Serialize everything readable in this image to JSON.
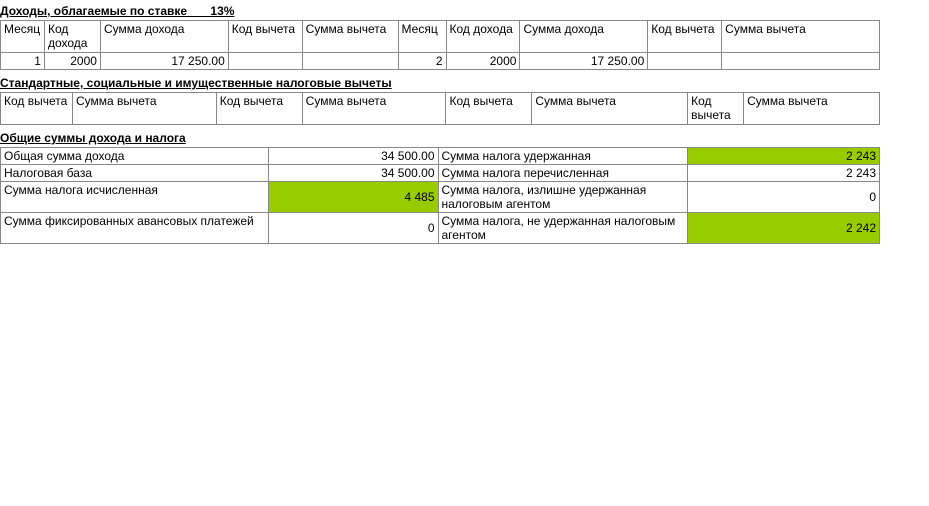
{
  "section3": {
    "title_prefix": "Доходы, облагаемые по ставке",
    "rate": "13%",
    "headers": {
      "month": "Месяц",
      "income_code": "Код дохода",
      "income_sum": "Сумма дохода",
      "deduct_code": "Код вычета",
      "deduct_sum": "Сумма вычета"
    },
    "left": {
      "month": "1",
      "income_code": "2000",
      "income_sum": "17 250.00",
      "deduct_code": "",
      "deduct_sum": ""
    },
    "right": {
      "month": "2",
      "income_code": "2000",
      "income_sum": "17 250.00",
      "deduct_code": "",
      "deduct_sum": ""
    }
  },
  "section4": {
    "title": "Стандартные, социальные и имущественные налоговые вычеты",
    "headers": {
      "deduct_code": "Код вычета",
      "deduct_sum": "Сумма вычета"
    }
  },
  "section5": {
    "title": "Общие суммы дохода и налога",
    "rows": [
      {
        "left_label": "Общая сумма дохода",
        "left_val": "34 500.00",
        "left_green": false,
        "right_label": "Сумма налога удержанная",
        "right_val": "2 243",
        "right_green": true
      },
      {
        "left_label": "Налоговая база",
        "left_val": "34 500.00",
        "left_green": false,
        "right_label": "Сумма налога перечисленная",
        "right_val": "2 243",
        "right_green": false
      },
      {
        "left_label": "Сумма налога исчисленная",
        "left_val": "4 485",
        "left_green": true,
        "right_label": "Сумма налога, излишне удержанная налоговым агентом",
        "right_val": "0",
        "right_green": false
      },
      {
        "left_label": "Сумма фиксированных авансовых платежей",
        "left_val": "0",
        "left_green": false,
        "right_label": "Сумма налога, не удержанная налоговым агентом",
        "right_val": "2 242",
        "right_green": true
      }
    ]
  }
}
